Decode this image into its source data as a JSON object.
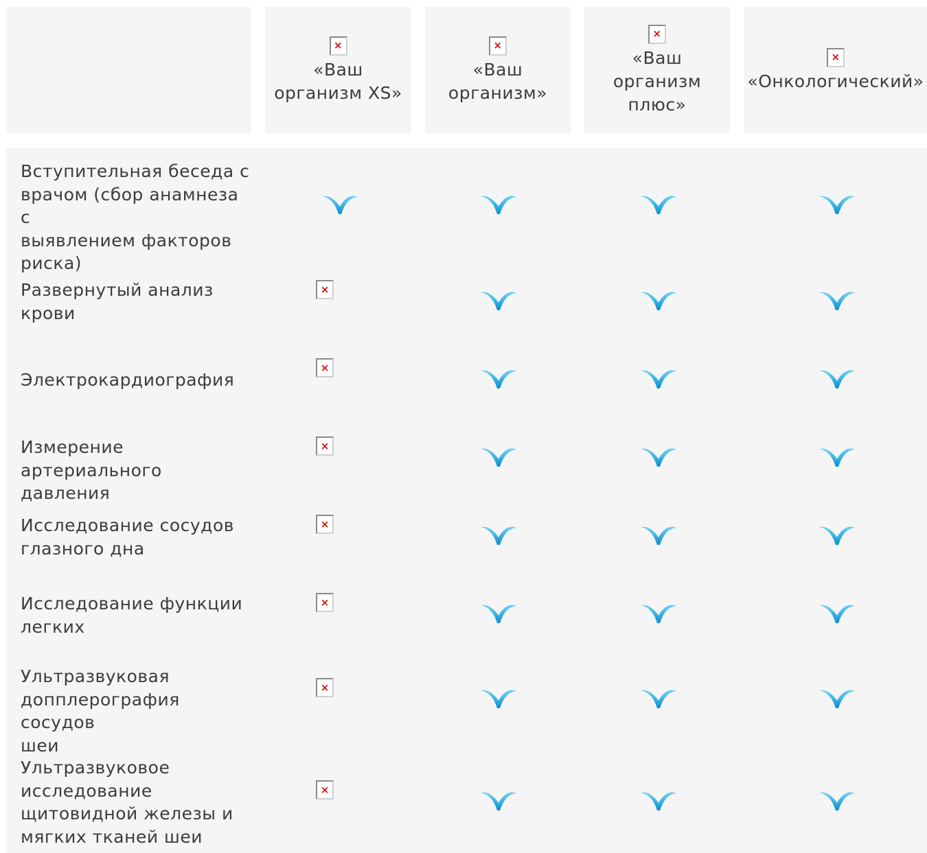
{
  "header": {
    "columns": [
      {
        "label": "«Ваш\nорганизм XS»",
        "icon": "broken-image-icon"
      },
      {
        "label": "«Ваш\nорганизм»",
        "icon": "broken-image-icon"
      },
      {
        "label": "«Ваш\nорганизм\nплюс»",
        "icon": "broken-image-icon"
      },
      {
        "label": "«Онкологический»",
        "icon": "broken-image-icon"
      }
    ]
  },
  "rows": [
    {
      "label": "Вступительная беседа с\nврачом (сбор анамнеза с\nвыявлением факторов\nриска)",
      "included": [
        true,
        true,
        true,
        true
      ]
    },
    {
      "label": "Развернутый анализ\nкрови",
      "included": [
        false,
        true,
        true,
        true
      ]
    },
    {
      "label": "Электрокардиография",
      "included": [
        false,
        true,
        true,
        true
      ]
    },
    {
      "label": "Измерение\nартериального давления",
      "included": [
        false,
        true,
        true,
        true
      ]
    },
    {
      "label": "Исследование сосудов\nглазного дна",
      "included": [
        false,
        true,
        true,
        true
      ]
    },
    {
      "label": "Исследование функции\nлегких",
      "included": [
        false,
        true,
        true,
        true
      ]
    },
    {
      "label": "Ультразвуковая\nдопплерография сосудов\nшеи",
      "included": [
        false,
        true,
        true,
        true
      ]
    },
    {
      "label": "Ультразвуковое\nисследование\nщитовидной железы и\nмягких тканей шеи",
      "included": [
        false,
        true,
        true,
        true
      ]
    }
  ],
  "colors": {
    "check": "#1aa8e0",
    "panel_bg": "#f5f5f5",
    "text": "#3c3c3c"
  }
}
